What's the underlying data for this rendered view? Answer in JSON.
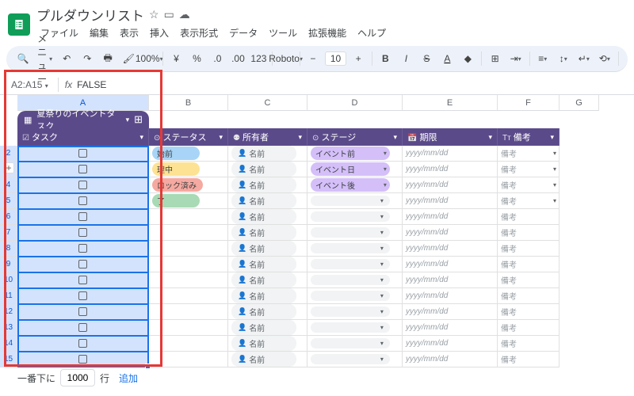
{
  "doc": {
    "title": "プルダウンリスト"
  },
  "menubar": [
    "ファイル",
    "編集",
    "表示",
    "挿入",
    "表示形式",
    "データ",
    "ツール",
    "拡張機能",
    "ヘルプ"
  ],
  "toolbar": {
    "menu_label": "メニュー",
    "zoom": "100%",
    "currency": "¥",
    "percent": "%",
    "dec_dec": ".0",
    "dec_inc": ".00",
    "num_fmt": "123",
    "font": "Roboto",
    "size": "10"
  },
  "formula": {
    "range": "A2:A15",
    "fx": "fx",
    "value": "FALSE"
  },
  "columns": {
    "letters": [
      "A",
      "B",
      "C",
      "D",
      "E",
      "F",
      "G"
    ],
    "widths": [
      166,
      100,
      100,
      120,
      120,
      78,
      50
    ]
  },
  "table": {
    "title": "夏祭りのイベントタスク"
  },
  "col_headers": [
    {
      "icon": "☑",
      "label": "タスク"
    },
    {
      "icon": "⊙",
      "label": "ステータス"
    },
    {
      "icon": "⚉",
      "label": "所有者"
    },
    {
      "icon": "⊙",
      "label": "ステージ"
    },
    {
      "icon": "📅",
      "label": "期限"
    },
    {
      "icon": "Tт",
      "label": "備考"
    }
  ],
  "statuses": [
    {
      "label": "始前",
      "bg": "#a8d5f7"
    },
    {
      "label": "理中",
      "bg": "#fde293"
    },
    {
      "label": "ロック済み",
      "bg": "#f5a9a0"
    },
    {
      "label": "了",
      "bg": "#a8dab5"
    }
  ],
  "stages": [
    {
      "label": "イベント前",
      "bg": "#d4bff9"
    },
    {
      "label": "イベント日",
      "bg": "#d4bff9"
    },
    {
      "label": "イベント後",
      "bg": "#d4bff9"
    }
  ],
  "owner_placeholder": "名前",
  "date_placeholder": "yyyy/mm/dd",
  "memo_placeholder": "備考",
  "row_count": 14,
  "bottom": {
    "prefix": "一番下に",
    "rows": "1000",
    "suffix": "行",
    "add": "追加"
  }
}
